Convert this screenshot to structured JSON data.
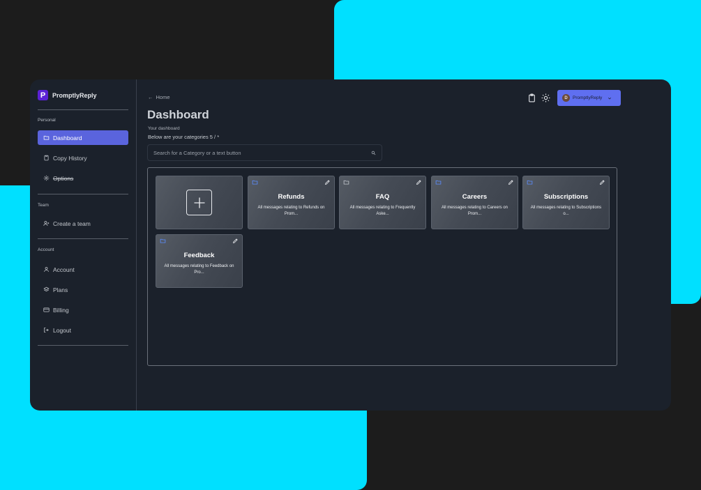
{
  "brand": {
    "logo_letter": "P",
    "name": "PromptlyReply"
  },
  "sidebar": {
    "sections": [
      {
        "label": "Personal",
        "items": [
          {
            "label": "Dashboard",
            "icon": "folder-icon",
            "active": true
          },
          {
            "label": "Copy History",
            "icon": "copy-icon"
          },
          {
            "label": "Options",
            "icon": "gear-icon"
          }
        ]
      },
      {
        "label": "Team",
        "items": [
          {
            "label": "Create a team",
            "icon": "user-plus-icon"
          }
        ]
      },
      {
        "label": "Account",
        "items": [
          {
            "label": "Account",
            "icon": "user-icon"
          },
          {
            "label": "Plans",
            "icon": "layers-icon"
          },
          {
            "label": "Billing",
            "icon": "card-icon"
          },
          {
            "label": "Logout",
            "icon": "logout-icon"
          }
        ]
      }
    ]
  },
  "header": {
    "breadcrumb": "Home",
    "title": "Dashboard",
    "subtitle": "Your dashboard",
    "categories_text": "Below are your categories 5 / *",
    "search_placeholder": "Search for a Category or a text button",
    "user": {
      "initial": "D",
      "name": "PromptlyReply"
    }
  },
  "categories": [
    {
      "title": "Refunds",
      "description": "All messages relating to Refunds on Prom...",
      "folder_color": "#5b8dff"
    },
    {
      "title": "FAQ",
      "description": "All messages relating to Frequently Aske...",
      "folder_color": "#c3c7cd"
    },
    {
      "title": "Careers",
      "description": "All messages relating to Careers on Prom...",
      "folder_color": "#5b8dff"
    },
    {
      "title": "Subscriptions",
      "description": "All messages relating to Subscriptions o...",
      "folder_color": "#5b8dff"
    },
    {
      "title": "Feedback",
      "description": "All messages relating to Feedback on Pro...",
      "folder_color": "#5b8dff"
    }
  ],
  "colors": {
    "accent": "#5a64dd",
    "cyan": "#00e0ff",
    "window_bg": "#1b212b"
  }
}
